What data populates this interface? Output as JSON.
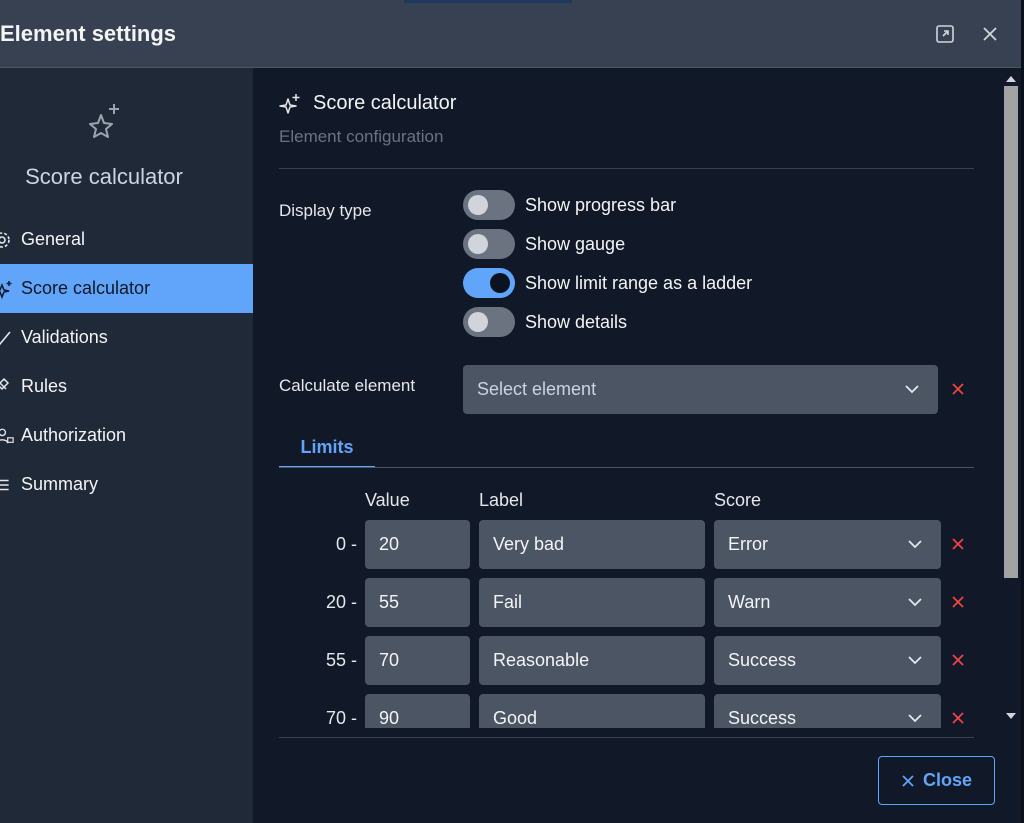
{
  "window": {
    "title": "Element settings",
    "icons": {
      "expand": "expand-icon",
      "close": "close-icon"
    }
  },
  "sidebar": {
    "hero_icon": "star-plus-icon",
    "hero_title": "Score calculator",
    "items": [
      {
        "label": "General",
        "icon": "gear-icon",
        "active": false
      },
      {
        "label": "Score calculator",
        "icon": "sparkle-icon",
        "active": true
      },
      {
        "label": "Validations",
        "icon": "check-icon",
        "active": false
      },
      {
        "label": "Rules",
        "icon": "rules-icon",
        "active": false
      },
      {
        "label": "Authorization",
        "icon": "user-lock-icon",
        "active": false
      },
      {
        "label": "Summary",
        "icon": "list-icon",
        "active": false
      }
    ]
  },
  "main": {
    "section_icon": "sparkle-icon",
    "section_title": "Score calculator",
    "section_subtitle": "Element configuration",
    "display_type": {
      "label": "Display type",
      "toggles": [
        {
          "label": "Show progress bar",
          "on": false
        },
        {
          "label": "Show gauge",
          "on": false
        },
        {
          "label": "Show limit range as a ladder",
          "on": true
        },
        {
          "label": "Show details",
          "on": false
        }
      ]
    },
    "calculate_element": {
      "label": "Calculate element",
      "placeholder": "Select element"
    },
    "tabs": [
      {
        "label": "Limits",
        "active": true
      }
    ],
    "limits": {
      "columns": {
        "value": "Value",
        "label": "Label",
        "score": "Score"
      },
      "rows": [
        {
          "from": "0 -",
          "value": "20",
          "label": "Very bad",
          "score": "Error"
        },
        {
          "from": "20 -",
          "value": "55",
          "label": "Fail",
          "score": "Warn"
        },
        {
          "from": "55 -",
          "value": "70",
          "label": "Reasonable",
          "score": "Success"
        },
        {
          "from": "70 -",
          "value": "90",
          "label": "Good",
          "score": "Success"
        }
      ]
    },
    "footer": {
      "close_label": "Close"
    }
  },
  "colors": {
    "accent": "#60a5fa",
    "danger": "#ef4444",
    "panel": "#1f2937",
    "background": "#111827",
    "input": "#4b5563"
  }
}
